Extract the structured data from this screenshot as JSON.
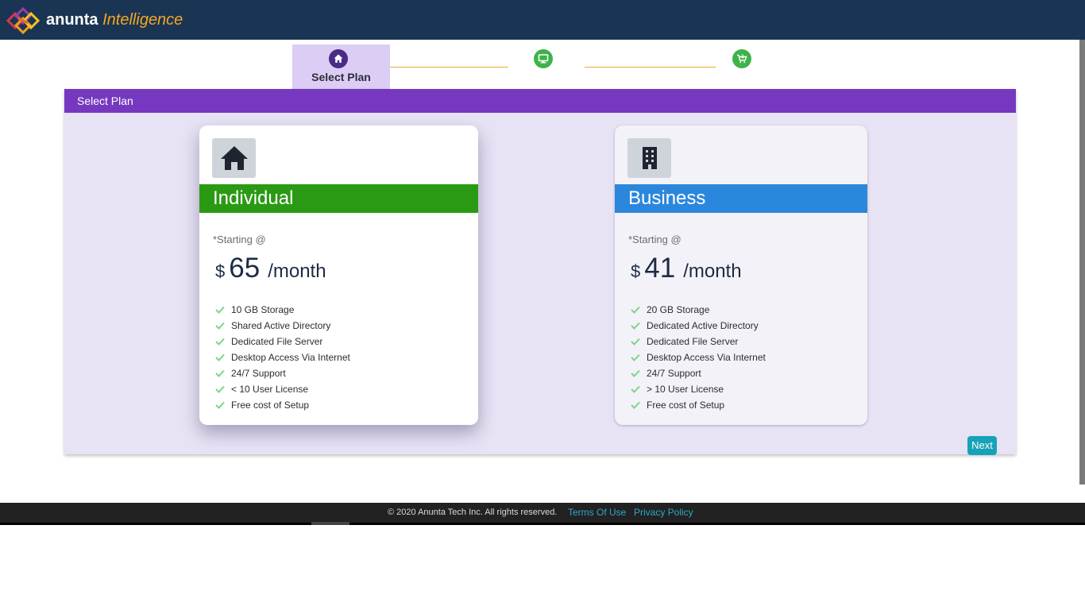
{
  "header": {
    "brand_name": "anunta",
    "brand_suffix": "Intelligence"
  },
  "stepper": {
    "steps": [
      {
        "label": "Select Plan",
        "icon": "home-icon",
        "active": true
      },
      {
        "label": "",
        "icon": "desktop-icon",
        "active": false
      },
      {
        "label": "",
        "icon": "cart-icon",
        "active": false
      }
    ]
  },
  "panel": {
    "title": "Select Plan"
  },
  "plans": [
    {
      "name": "Individual",
      "icon": "house-icon",
      "band_color": "#2a9a14",
      "starting": "*Starting @",
      "currency": "$",
      "price": "65",
      "period": "/month",
      "features": [
        "10 GB Storage",
        "Shared Active Directory",
        "Dedicated File Server",
        "Desktop Access Via Internet",
        "24/7 Support",
        "< 10 User License",
        "Free cost of Setup"
      ]
    },
    {
      "name": "Business",
      "icon": "building-icon",
      "band_color": "#2b87dc",
      "starting": "*Starting @",
      "currency": "$",
      "price": "41",
      "period": "/month",
      "features": [
        "20 GB Storage",
        "Dedicated Active Directory",
        "Dedicated File Server",
        "Desktop Access Via Internet",
        "24/7 Support",
        "> 10 User License",
        "Free cost of Setup"
      ]
    }
  ],
  "actions": {
    "next_label": "Next"
  },
  "footer": {
    "copyright": "© 2020 Anunta Tech Inc. All rights reserved.",
    "terms": "Terms Of Use",
    "privacy": "Privacy Policy"
  },
  "colors": {
    "topbar": "#1a3553",
    "accent_purple": "#7638c0",
    "step_done": "#3db34a",
    "check_green": "#7fd38a",
    "link": "#2ea7c9"
  }
}
